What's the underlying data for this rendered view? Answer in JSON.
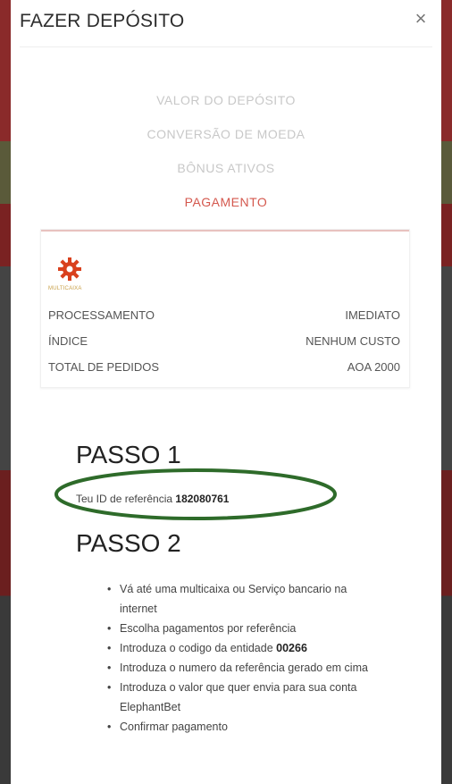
{
  "modal": {
    "title": "FAZER DEPÓSITO",
    "close_label": "×"
  },
  "steps": [
    {
      "label": "VALOR DO DEPÓSITO",
      "active": false
    },
    {
      "label": "CONVERSÃO DE MOEDA",
      "active": false
    },
    {
      "label": "BÔNUS ATIVOS",
      "active": false
    },
    {
      "label": "PAGAMENTO",
      "active": true
    }
  ],
  "payment_card": {
    "logo_text": "MULTICAIXA",
    "rows": [
      {
        "key": "PROCESSAMENTO",
        "value": "IMEDIATO"
      },
      {
        "key": "ÍNDICE",
        "value": "NENHUM CUSTO"
      },
      {
        "key": "TOTAL DE PEDIDOS",
        "value": "AOA 2000"
      }
    ]
  },
  "passo1": {
    "title": "PASSO 1",
    "ref_label": "Teu ID de referência",
    "ref_id": "182080761"
  },
  "passo2": {
    "title": "PASSO 2",
    "items": [
      {
        "text": "Vá até uma multicaixa ou Serviço bancario na internet",
        "bold": ""
      },
      {
        "text": "Escolha pagamentos por referência",
        "bold": ""
      },
      {
        "text": "Introduza o codigo da entidade ",
        "bold": "00266"
      },
      {
        "text": "Introduza o numero da referência gerado em cima",
        "bold": ""
      },
      {
        "text": "Introduza o valor que quer envia para sua conta ElephantBet",
        "bold": ""
      },
      {
        "text": "Confirmar pagamento",
        "bold": ""
      }
    ]
  },
  "colors": {
    "active_step": "#d4584e",
    "inactive_step": "#c8c8c8",
    "highlight_oval": "#2e6b2a",
    "logo": "#d9411e"
  }
}
